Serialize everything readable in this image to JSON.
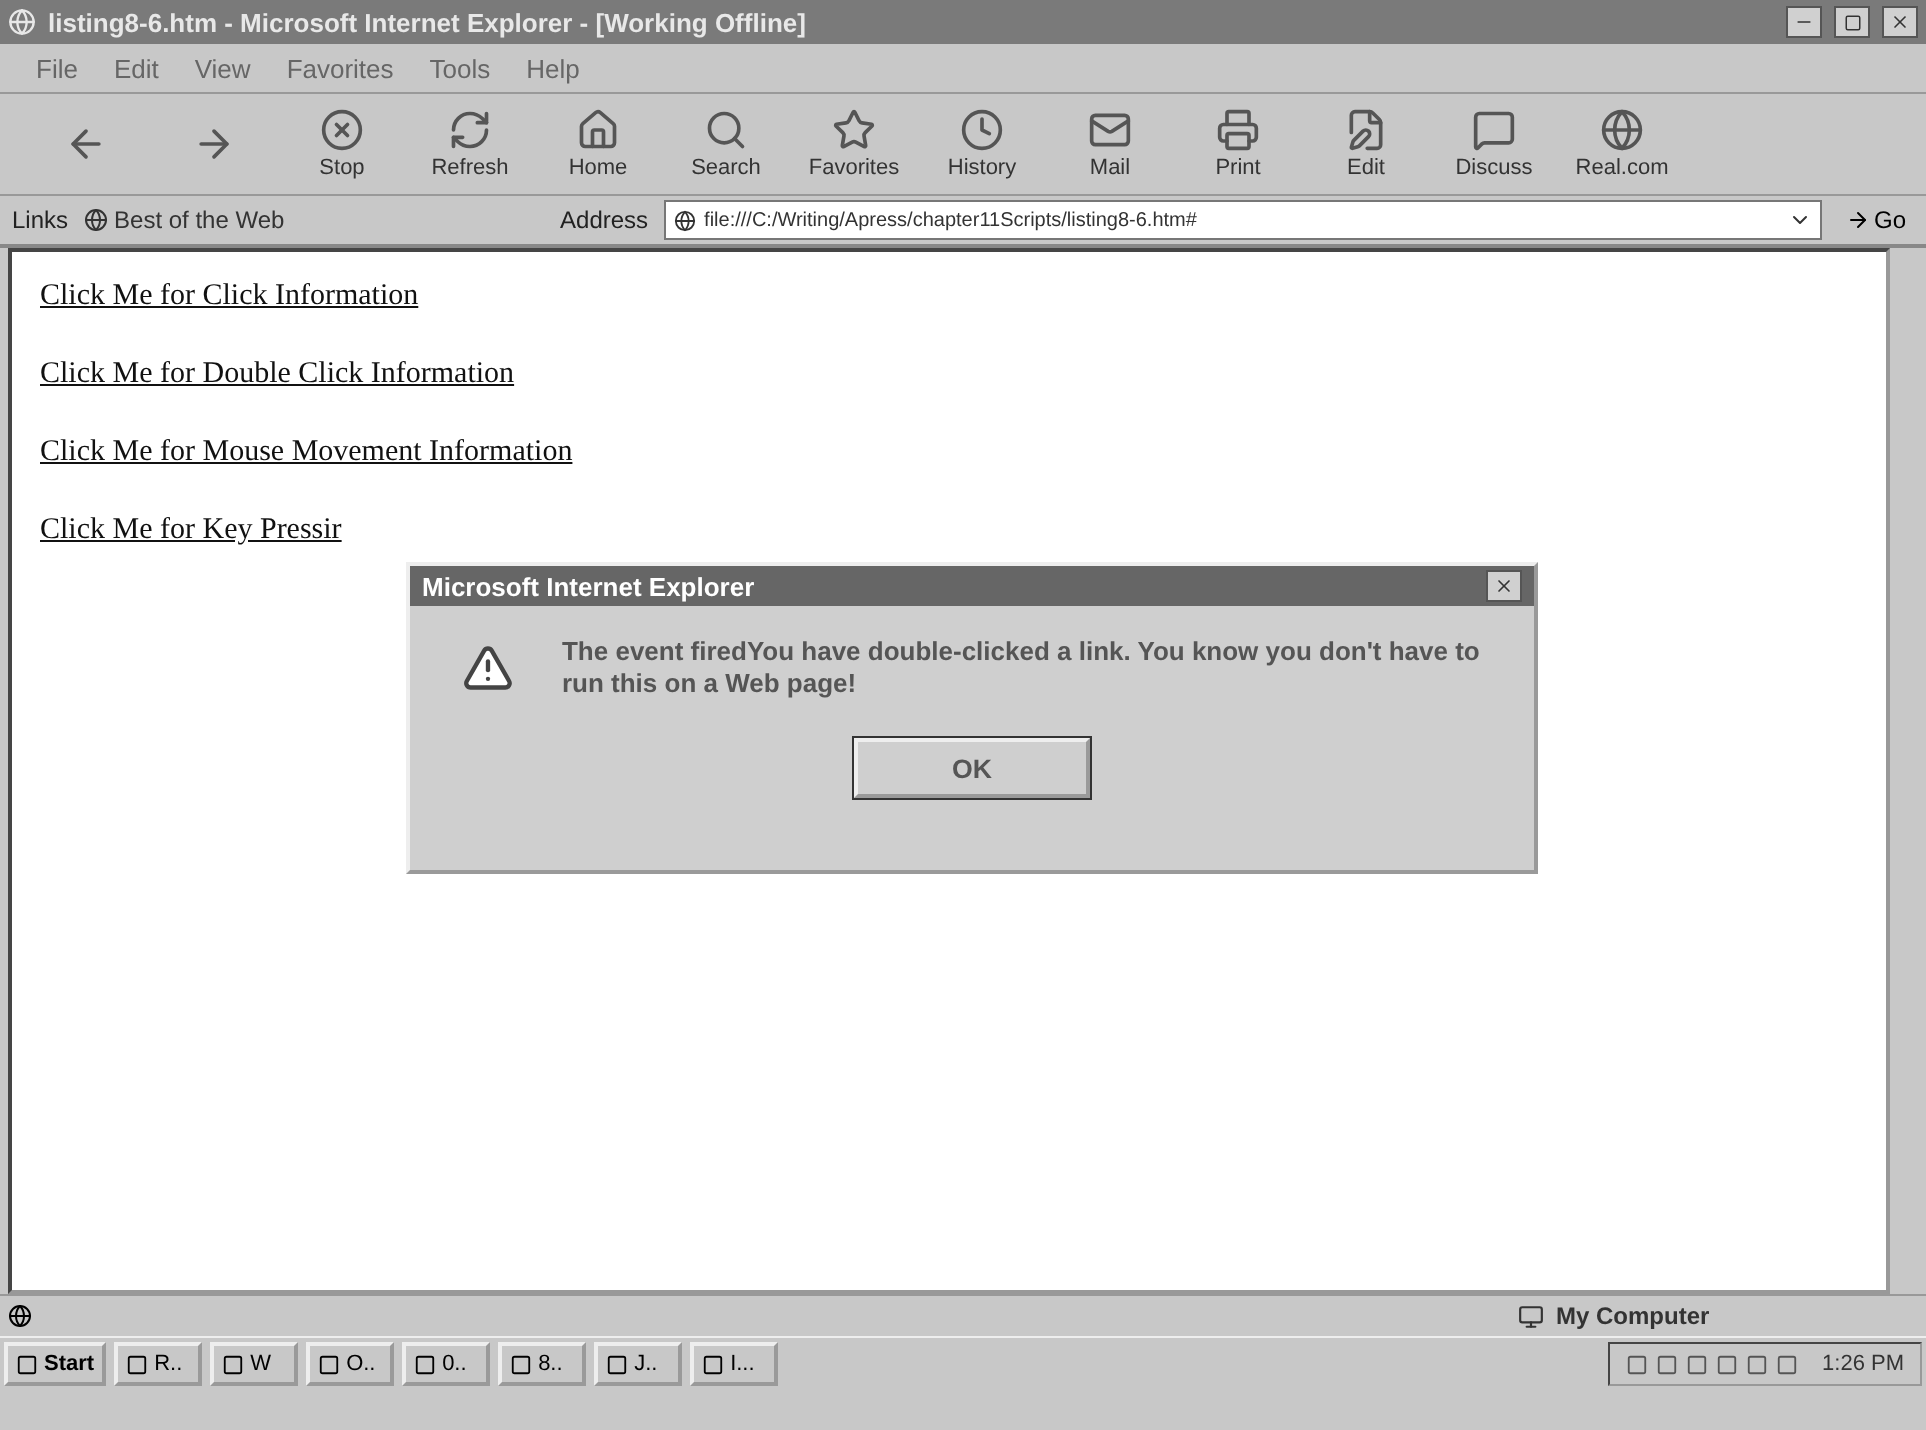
{
  "window": {
    "title": "listing8-6.htm - Microsoft Internet Explorer - [Working Offline]"
  },
  "menu": [
    "File",
    "Edit",
    "View",
    "Favorites",
    "Tools",
    "Help"
  ],
  "toolbar": [
    {
      "kind": "back"
    },
    {
      "kind": "forward"
    },
    {
      "kind": "stop",
      "label": "Stop"
    },
    {
      "kind": "refresh",
      "label": "Refresh"
    },
    {
      "kind": "home",
      "label": "Home"
    },
    {
      "kind": "search",
      "label": "Search"
    },
    {
      "kind": "favorites",
      "label": "Favorites"
    },
    {
      "kind": "history",
      "label": "History"
    },
    {
      "kind": "mail",
      "label": "Mail"
    },
    {
      "kind": "print",
      "label": "Print"
    },
    {
      "kind": "edit",
      "label": "Edit"
    },
    {
      "kind": "discuss",
      "label": "Discuss"
    },
    {
      "kind": "real",
      "label": "Real.com"
    }
  ],
  "links_bar": {
    "label": "Links",
    "items": [
      "Best of the Web"
    ]
  },
  "address_bar": {
    "label": "Address",
    "value": "file:///C:/Writing/Apress/chapter11Scripts/listing8-6.htm#",
    "go": "Go"
  },
  "page_links": [
    "Click Me for Click Information",
    "Click Me for Double Click Information",
    "Click Me for Mouse Movement Information",
    "Click Me for Key Pressir"
  ],
  "dialog": {
    "title": "Microsoft Internet Explorer",
    "message": "The event firedYou have double-clicked a link. You know you don't have to run this on a Web page!",
    "button": "OK"
  },
  "status_bar": {
    "zone": "My Computer"
  },
  "taskbar": {
    "start": "Start",
    "buttons": [
      "R..",
      "W",
      "O..",
      "0..",
      "8..",
      "J..",
      "I..."
    ],
    "clock": "1:26 PM"
  }
}
